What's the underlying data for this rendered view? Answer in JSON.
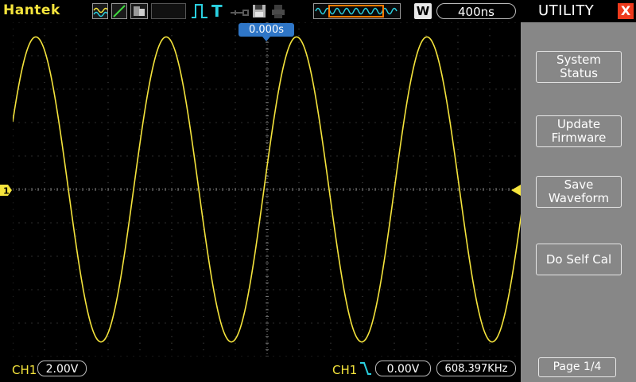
{
  "colors": {
    "trace": "#f5e43c",
    "grid": "#5a5a5a",
    "axis": "#7a7a7a",
    "menu_bg": "#878787",
    "trigger_blue": "#2f76c7",
    "close_red": "#ee3a1c",
    "memory_window": "#ff7a00"
  },
  "header": {
    "brand": "Hantek",
    "trigger_type_label": "T",
    "timebase_mode": "W",
    "timebase": "400ns"
  },
  "icons": {
    "wave_icon": "waveform-icon",
    "ramp_icon": "ramp-icon",
    "trigger_edge_icon": "rising-edge-icon",
    "probe_icon": "probe-icon",
    "disk_icon": "save-disk-icon",
    "print_icon": "printer-icon"
  },
  "screen": {
    "trigger_position": "0.000s",
    "ch1_marker": "1"
  },
  "chart_data": {
    "type": "line",
    "title": "",
    "xlabel": "",
    "ylabel": "",
    "x_divisions": 16,
    "y_divisions": 10,
    "x_range_div": [
      -8,
      8
    ],
    "y_range_div": [
      -4,
      4
    ],
    "series": [
      {
        "waveform": "sine",
        "amplitude_div": 3.65,
        "offset_div": 0,
        "period_div": 4.1,
        "phase_zero_crossing_div": -6.25
      }
    ]
  },
  "footer": {
    "ch1_label": "CH1",
    "ch1_volts_per_div": "2.00V",
    "trigger_source": "CH1",
    "trigger_level": "0.00V",
    "frequency": "608.397KHz"
  },
  "menu": {
    "title": "UTILITY",
    "close_glyph": "X",
    "buttons": [
      {
        "label": "System\nStatus"
      },
      {
        "label": "Update\nFirmware"
      },
      {
        "label": "Save\nWaveform"
      },
      {
        "label": "Do Self Cal"
      }
    ],
    "page": "Page 1/4"
  }
}
